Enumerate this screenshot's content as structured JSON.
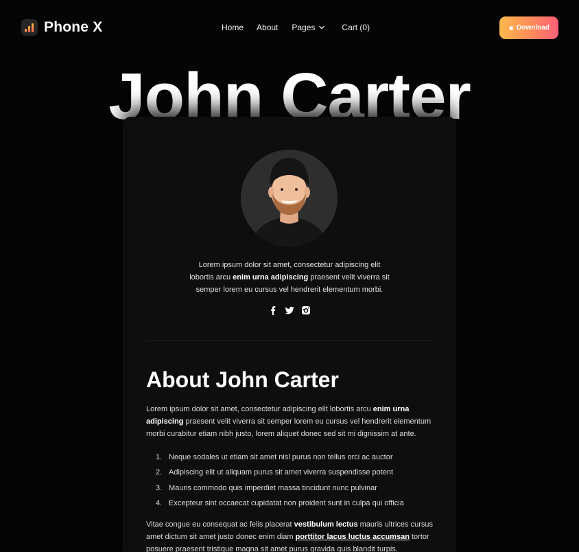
{
  "brand": {
    "name": "Phone X"
  },
  "nav": {
    "home": "Home",
    "about": "About",
    "pages": "Pages",
    "cart": "Cart (0)"
  },
  "cta": {
    "download": "Download"
  },
  "hero": {
    "title": "John Carter"
  },
  "profile": {
    "intro_1": "Lorem ipsum dolor sit amet, consectetur adipiscing elit lobortis arcu ",
    "intro_bold": "enim urna adipiscing",
    "intro_2": " praesent velit viverra sit semper lorem eu cursus vel hendrerit elementum morbi.",
    "socials": [
      "facebook-icon",
      "twitter-icon",
      "instagram-icon"
    ]
  },
  "about": {
    "title": "About John Carter",
    "p1_a": "Lorem ipsum dolor sit amet, consectetur adipiscing elit lobortis arcu ",
    "p1_bold": "enim urna adipiscing",
    "p1_b": " praesent velit viverra sit semper lorem eu cursus vel hendrerit elementum morbi curabitur etiam nibh justo, lorem aliquet donec sed sit mi dignissim at ante.",
    "list": [
      {
        "num": "1.",
        "text": "Neque sodales ut etiam sit amet nisl purus non tellus orci ac auctor"
      },
      {
        "num": "2.",
        "text": "Adipiscing elit ut aliquam purus sit amet viverra suspendisse potent"
      },
      {
        "num": "3.",
        "text": "Mauris commodo quis imperdiet massa tincidunt nunc pulvinar"
      },
      {
        "num": "4.",
        "text": "Excepteur sint occaecat cupidatat non proident sunt in culpa qui officia"
      }
    ],
    "p2_a": "Vitae congue eu consequat ac felis placerat ",
    "p2_bold": "vestibulum lectus",
    "p2_b": " mauris ultrices cursus amet dictum sit amet justo donec enim diam ",
    "p2_link": "porttitor lacus luctus accumsan",
    "p2_c": " tortor posuere praesent tristique magna sit amet purus gravida quis blandit turpis."
  },
  "colors": {
    "background": "#050505",
    "card": "#0e0e0e",
    "accent_start": "#ffb84d",
    "accent_end": "#ff5f78"
  }
}
